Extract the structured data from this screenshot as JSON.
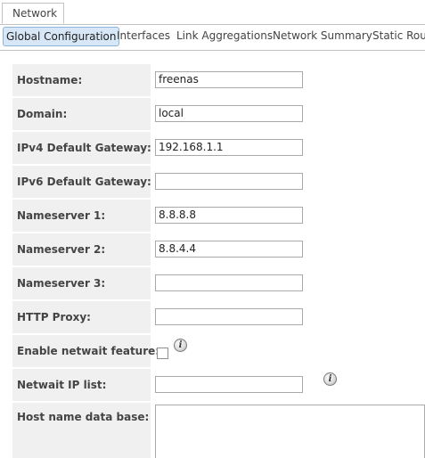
{
  "top_tab": {
    "label": "Network"
  },
  "sub_tabs": [
    {
      "label": "Global Configuration",
      "active": true
    },
    {
      "label": "Interfaces"
    },
    {
      "label": "Link Aggregations"
    },
    {
      "label": "Network Summary"
    },
    {
      "label": "Static Rout"
    }
  ],
  "form": {
    "hostname": {
      "label": "Hostname:",
      "value": "freenas"
    },
    "domain": {
      "label": "Domain:",
      "value": "local"
    },
    "ipv4_gateway": {
      "label": "IPv4 Default Gateway:",
      "value": "192.168.1.1"
    },
    "ipv6_gateway": {
      "label": "IPv6 Default Gateway:",
      "value": ""
    },
    "nameserver1": {
      "label": "Nameserver 1:",
      "value": "8.8.8.8"
    },
    "nameserver2": {
      "label": "Nameserver 2:",
      "value": "8.8.4.4"
    },
    "nameserver3": {
      "label": "Nameserver 3:",
      "value": ""
    },
    "http_proxy": {
      "label": "HTTP Proxy:",
      "value": ""
    },
    "netwait_enable": {
      "label": "Enable netwait feature:",
      "checked": false
    },
    "netwait_ips": {
      "label": "Netwait IP list:",
      "value": ""
    },
    "hosts_db": {
      "label": "Host name data base:",
      "value": ""
    }
  },
  "icons": {
    "info": "info-icon"
  },
  "info_glyph": "i"
}
